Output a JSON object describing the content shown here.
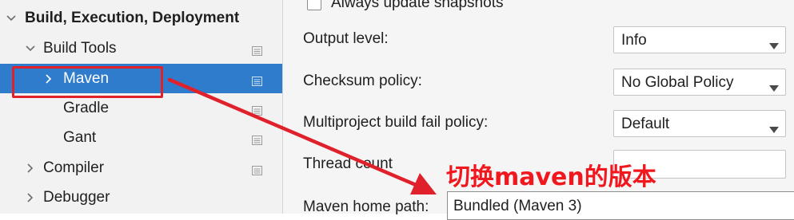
{
  "sidebar": {
    "items": [
      {
        "label": "Build, Execution, Deployment",
        "expanded": true,
        "bold": true,
        "has_page_icon": false
      },
      {
        "label": "Build Tools",
        "expanded": true,
        "bold": false,
        "has_page_icon": true
      },
      {
        "label": "Maven",
        "expanded": false,
        "selected": true,
        "has_page_icon": true
      },
      {
        "label": "Gradle",
        "has_page_icon": true
      },
      {
        "label": "Gant",
        "has_page_icon": true
      },
      {
        "label": "Compiler",
        "expanded": false,
        "has_page_icon": true
      },
      {
        "label": "Debugger",
        "expanded": false,
        "has_page_icon": false
      }
    ]
  },
  "main": {
    "always_update_snapshots": {
      "label": "Always update snapshots",
      "checked": false
    },
    "output_level": {
      "label": "Output level:",
      "value": "Info"
    },
    "checksum_policy": {
      "label": "Checksum policy:",
      "value": "No Global Policy"
    },
    "multiproject_fail_policy": {
      "label": "Multiproject build fail policy:",
      "value": "Default"
    },
    "thread_count": {
      "label": "Thread count",
      "value": ""
    },
    "maven_home_path": {
      "label": "Maven home path:",
      "value": "Bundled (Maven 3)"
    }
  },
  "annotation": {
    "text": "切换maven的版本",
    "color": "#f0181e"
  },
  "colors": {
    "selection": "#2f7bcc",
    "annotation_red": "#e0202a"
  }
}
